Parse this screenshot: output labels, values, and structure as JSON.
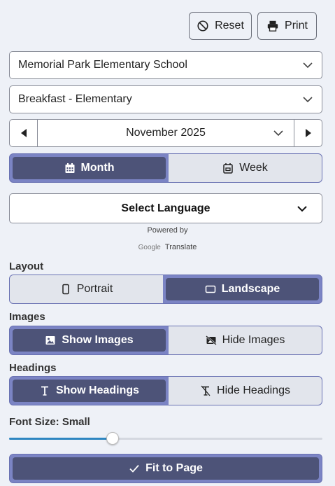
{
  "toolbar": {
    "reset_label": "Reset",
    "print_label": "Print"
  },
  "school_select": {
    "value": "Memorial Park Elementary School"
  },
  "menu_select": {
    "value": "Breakfast - Elementary"
  },
  "month_nav": {
    "value": "November 2025"
  },
  "view_toggle": {
    "month_label": "Month",
    "week_label": "Week",
    "selected": "Month"
  },
  "language": {
    "label": "Select Language",
    "powered_by": "Powered by",
    "google": "Google",
    "translate": "Translate"
  },
  "layout": {
    "heading": "Layout",
    "portrait_label": "Portrait",
    "landscape_label": "Landscape",
    "selected": "Landscape"
  },
  "images": {
    "heading": "Images",
    "show_label": "Show Images",
    "hide_label": "Hide Images",
    "selected": "Show Images"
  },
  "headings": {
    "heading": "Headings",
    "show_label": "Show Headings",
    "hide_label": "Hide Headings",
    "selected": "Show Headings"
  },
  "font_size": {
    "label": "Font Size: Small",
    "level": 0.33
  },
  "fit_button": {
    "label": "Fit to Page"
  },
  "colors": {
    "accent": "#4d5378",
    "toggle_bg": "#7b84c4",
    "slider": "#2e86c1"
  }
}
